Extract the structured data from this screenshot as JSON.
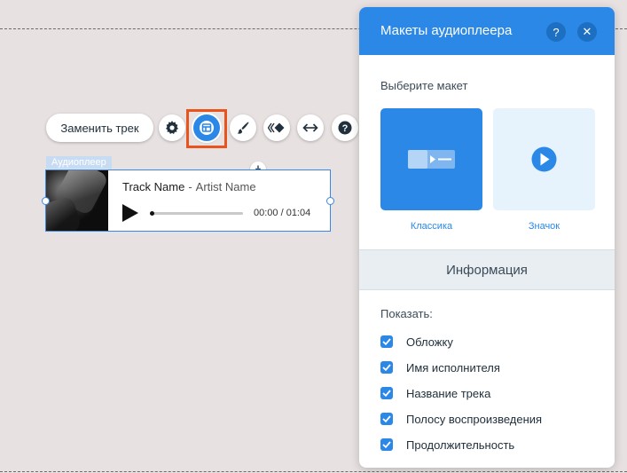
{
  "toolbar": {
    "replace_label": "Заменить трек"
  },
  "component_label": "Аудиоплеер",
  "player": {
    "track_name": "Track Name",
    "separator": "-",
    "artist_name": "Artist Name",
    "time": "00:00 / 01:04",
    "progress": 0
  },
  "panel": {
    "title": "Макеты аудиоплеера",
    "help_symbol": "?",
    "close_symbol": "✕",
    "choose_label": "Выберите макет",
    "layouts": [
      {
        "label": "Классика",
        "selected": true
      },
      {
        "label": "Значок",
        "selected": false
      }
    ],
    "section_title": "Информация",
    "show_label": "Показать:",
    "checkboxes": [
      {
        "label": "Обложку",
        "checked": true
      },
      {
        "label": "Имя исполнителя",
        "checked": true
      },
      {
        "label": "Название трека",
        "checked": true
      },
      {
        "label": "Полосу воспроизведения",
        "checked": true
      },
      {
        "label": "Продолжительность",
        "checked": true
      }
    ]
  },
  "colors": {
    "accent": "#2b88e6",
    "highlight": "#e8541c",
    "canvas": "#e7e1e1"
  },
  "icons": [
    "gear-icon",
    "layout-icon",
    "brush-icon",
    "animation-icon",
    "stretch-icon",
    "help-icon",
    "download-icon",
    "play-icon",
    "check-icon"
  ]
}
